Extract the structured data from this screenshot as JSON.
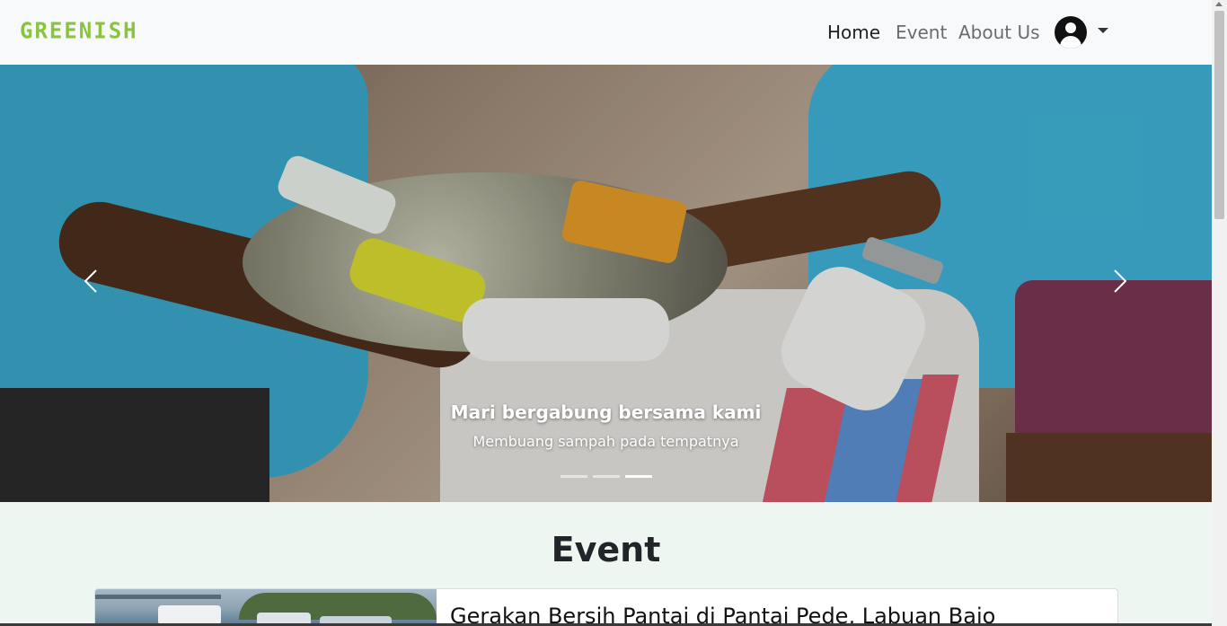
{
  "navbar": {
    "brand": "GREENISH",
    "links": [
      {
        "label": "Home",
        "active": true
      },
      {
        "label": "Event",
        "active": false
      },
      {
        "label": "About Us",
        "active": false
      }
    ],
    "user_icon": "user-circle-icon",
    "dropdown_icon": "caret-down-icon"
  },
  "hero": {
    "caption_title": "Mari bergabung bersama kami",
    "caption_subtitle": "Membuang sampah pada tempatnya",
    "slide_count": 3,
    "active_slide": 3,
    "prev_icon": "chevron-left-icon",
    "next_icon": "chevron-right-icon"
  },
  "events_section": {
    "title": "Event",
    "cards": [
      {
        "title": "Gerakan Bersih Pantai di Pantai Pede, Labuan Bajo"
      }
    ]
  },
  "colors": {
    "brand": "#8ac43f",
    "navbar_bg": "#f8f9fa",
    "page_bg": "#eef6f1"
  }
}
